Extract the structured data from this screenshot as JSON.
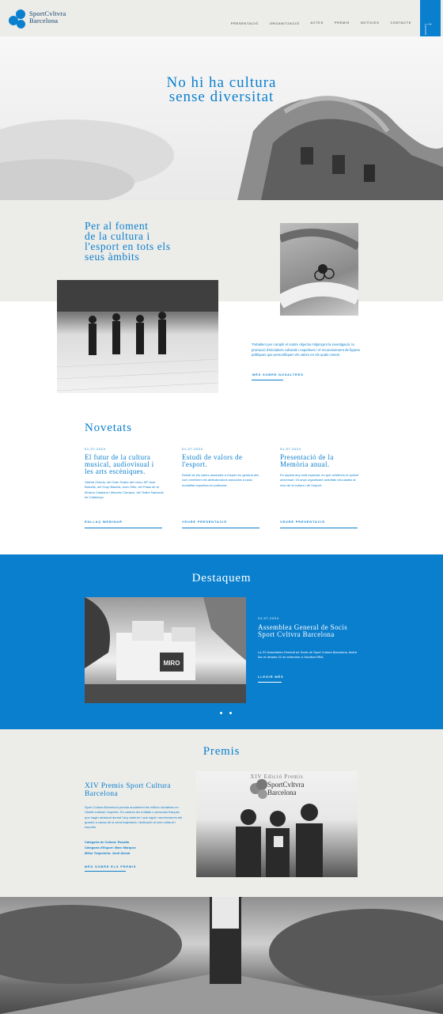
{
  "brand": {
    "name_line1": "SportCvltvra",
    "name_line2": "Barcelona",
    "accent": "#0a7fce"
  },
  "nav": {
    "items": [
      "presentació",
      "organització",
      "actes",
      "premis",
      "notícies",
      "contacte"
    ],
    "side_tab_label": "Inicia sessió",
    "side_tab_icon": "arrow-right-icon"
  },
  "hero": {
    "title_line1": "No hi ha cultura",
    "title_line2": "sense diversitat"
  },
  "intro": {
    "title_lines": [
      "Per al foment",
      "de la cultura i",
      "l'esport en tots els",
      "seus àmbits"
    ],
    "text": "Treballem per complir el nostre objectiu mitjançant la investigació, la promoció d'iniciatives culturals i esportives i el reconeixement de figures públiques que personifiquen els valors en els quals creiem.",
    "link": "Més sobre nosaltres"
  },
  "novetats": {
    "title": "Novetats",
    "items": [
      {
        "date": "01-07-2024",
        "title": "El futur de la cultura musical, audiovisual i les arts escèniques.",
        "desc": "Valentí Oviedo, del Gran Teatre del Liceu; Mª José Balcells, del Grup Balañà; Joan Oller, del Palau de la Música Catalana i Marcelo Campos, del Teatre Nacional de Catalunya.",
        "link": "Enllaç webinar"
      },
      {
        "date": "01-07-2024",
        "title": "Estudi de valors de l'esport.",
        "desc": "Estudi de els valors associats a l'esport en general així com cerebrem els atributs/valors associats a cada modalitat esportiva en particular.",
        "link": "Veure presentació"
      },
      {
        "date": "01-07-2024",
        "title": "Presentació de la Memòria anual.",
        "desc": "En aquest any molt especial, en què celebrem el quinzè aniversari: 15 anys organitzant activitats vinculades al món de la cultura i de l'esport.",
        "link": "Veure presentació"
      }
    ]
  },
  "destaquem": {
    "title": "Destaquem",
    "date": "24-07-2024",
    "headline": "Assemblea General de Socis Sport Cvltvra Barcelona",
    "desc": "La XV Assemblea General de Socis de Sport Cultura Barcelona, tindrà lloc el dimarts 22 de setembre a l'Auditori RBA.",
    "link": "Llegir més",
    "photo_label": "MIRO"
  },
  "premis": {
    "title": "Premis",
    "headline": "XIV Premis Sport Cultura Barcelona",
    "desc": "Sport Cultura Barcelona premia anualment les millors iniciatives en l'àmbit cultural i esportiu. Es valoren les entitats o persones físiques que hagin destacat durant l'any anterior i que siguin mereixedores del guardó a causa de la seva trajectòria i dedicació al món cultural i esportiu.",
    "categories": [
      "Categoria de Cultura: Rosalía",
      "Categoria d'Esport: Marc Márquez",
      "Millor Trajectòria: Jordi Alemà"
    ],
    "link": "Més sobre els premis",
    "photo_title": "XIV Edició Premis",
    "photo_brand_line1": "SportCvltvra",
    "photo_brand_line2": "Barcelona"
  }
}
